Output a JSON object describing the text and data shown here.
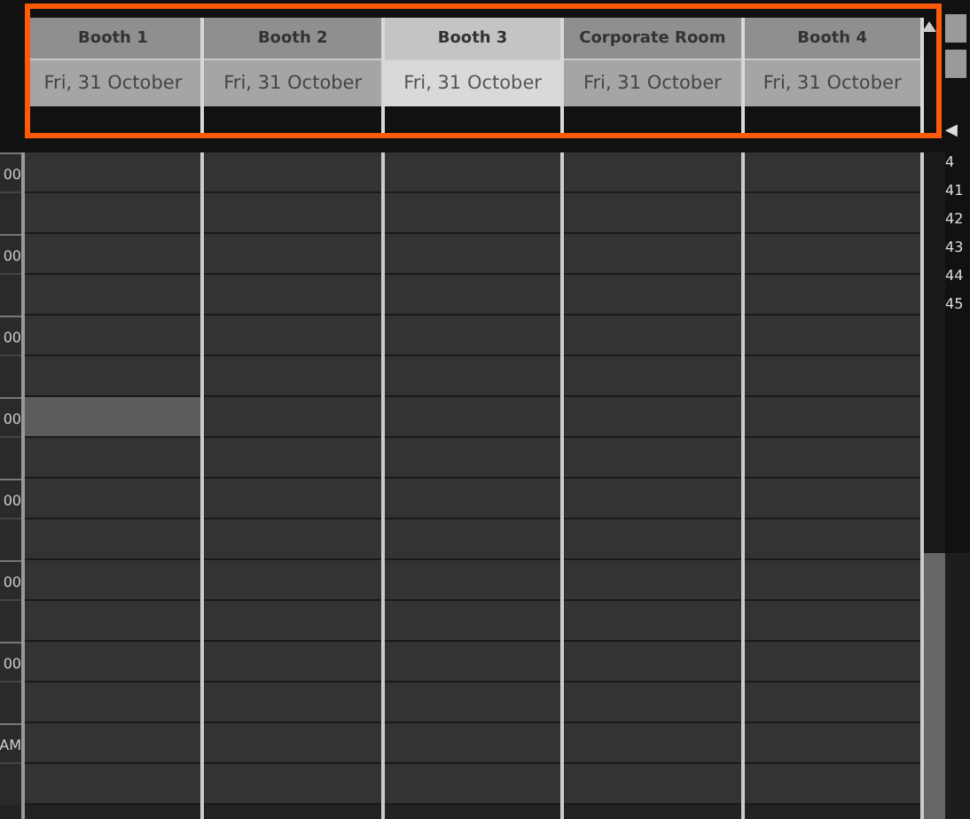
{
  "columns": [
    {
      "name": "Booth 1",
      "date": "Fri, 31 October",
      "selected": false
    },
    {
      "name": "Booth 2",
      "date": "Fri, 31 October",
      "selected": false
    },
    {
      "name": "Booth 3",
      "date": "Fri, 31 October",
      "selected": true
    },
    {
      "name": "Corporate Room",
      "date": "Fri, 31 October",
      "selected": false
    },
    {
      "name": "Booth 4",
      "date": "Fri, 31 October",
      "selected": false
    }
  ],
  "hours": [
    {
      "label": "00",
      "cells": [
        {
          "selected": false
        },
        {
          "selected": false
        },
        {
          "selected": false
        },
        {
          "selected": false
        },
        {
          "selected": false
        }
      ]
    },
    {
      "label": "00",
      "cells": [
        {
          "selected": false
        },
        {
          "selected": false
        },
        {
          "selected": false
        },
        {
          "selected": false
        },
        {
          "selected": false
        }
      ]
    },
    {
      "label": "00",
      "cells": [
        {
          "selected": false
        },
        {
          "selected": false
        },
        {
          "selected": false
        },
        {
          "selected": false
        },
        {
          "selected": false
        }
      ]
    },
    {
      "label": "00",
      "cells": [
        {
          "selected": true
        },
        {
          "selected": false
        },
        {
          "selected": false
        },
        {
          "selected": false
        },
        {
          "selected": false
        }
      ]
    },
    {
      "label": "00",
      "cells": [
        {
          "selected": false
        },
        {
          "selected": false
        },
        {
          "selected": false
        },
        {
          "selected": false
        },
        {
          "selected": false
        }
      ]
    },
    {
      "label": "00",
      "cells": [
        {
          "selected": false
        },
        {
          "selected": false
        },
        {
          "selected": false
        },
        {
          "selected": false
        },
        {
          "selected": false
        }
      ]
    },
    {
      "label": "00",
      "cells": [
        {
          "selected": false
        },
        {
          "selected": false
        },
        {
          "selected": false
        },
        {
          "selected": false
        },
        {
          "selected": false
        }
      ]
    },
    {
      "label": "AM",
      "cells": [
        {
          "selected": false
        },
        {
          "selected": false
        },
        {
          "selected": false
        },
        {
          "selected": false
        },
        {
          "selected": false
        }
      ]
    }
  ],
  "side_panel": {
    "arrow": "◀",
    "numbers": [
      "4",
      "41",
      "42",
      "43",
      "44",
      "45"
    ]
  }
}
